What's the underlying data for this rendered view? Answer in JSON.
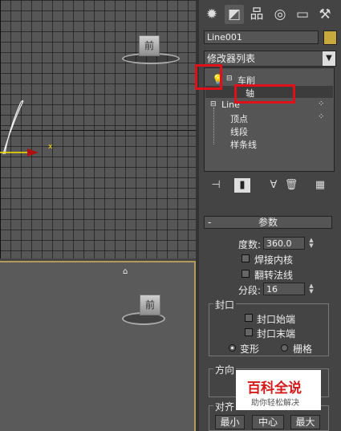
{
  "viewport_top": {
    "cube_label": "前"
  },
  "viewport_bottom": {
    "cube_label": "前"
  },
  "axis_label": "x",
  "panel": {
    "tabs": [
      "create-icon",
      "modify-icon",
      "hierarchy-icon",
      "motion-icon",
      "display-icon",
      "utilities-icon"
    ],
    "object_name": "Line001",
    "object_color": "#c8a93d",
    "modifier_list_label": "修改器列表",
    "stack": {
      "lathe": "车削",
      "axis": "轴",
      "line": "Line",
      "vertex": "顶点",
      "segment": "线段",
      "spline": "样条线"
    },
    "params": {
      "title": "参数",
      "degrees_label": "度数:",
      "degrees_value": "360.0",
      "weld_core": "焊接内核",
      "flip_normals": "翻转法线",
      "segments_label": "分段:",
      "segments_value": "16",
      "capping_title": "封口",
      "cap_start": "封口始端",
      "cap_end": "封口末端",
      "morph": "变形",
      "grid": "栅格",
      "direction_title": "方向",
      "align_title": "对齐",
      "min": "最小",
      "center": "中心",
      "max": "最大"
    }
  },
  "watermark": {
    "brand": "百科全说",
    "slogan": "助你轻松解决"
  }
}
